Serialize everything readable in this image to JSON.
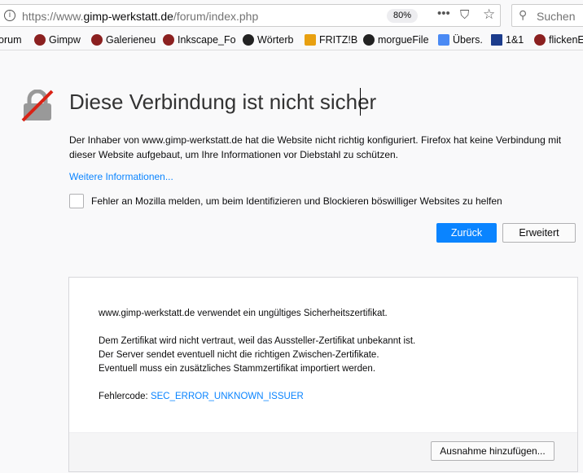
{
  "toolbar": {
    "url_prefix": "https://www.",
    "url_domain": "gimp-werkstatt.de",
    "url_path": "/forum/index.php",
    "zoom": "80%",
    "search_placeholder": "Suchen"
  },
  "bookmarks": [
    "orum",
    "Gimpw",
    "Galerieneu",
    "Inkscape_Fo",
    "Wörterb",
    "FRITZ!B",
    "morgueFile",
    "Übers.",
    "1&1",
    "flickenE"
  ],
  "error": {
    "title": "Diese Verbindung ist nicht sicher",
    "description": "Der Inhaber von www.gimp-werkstatt.de hat die Website nicht richtig konfiguriert. Firefox hat keine Verbindung mit dieser Website aufgebaut, um Ihre Informationen vor Diebstahl zu schützen.",
    "more_link": "Weitere Informationen...",
    "report_label": "Fehler an Mozilla melden, um beim Identifizieren und Blockieren böswilliger Websites zu helfen",
    "back_button": "Zurück",
    "advanced_button": "Erweitert"
  },
  "advanced": {
    "line1": "www.gimp-werkstatt.de verwendet ein ungültiges Sicherheitszertifikat.",
    "line2": "Dem Zertifikat wird nicht vertraut, weil das Aussteller-Zertifikat unbekannt ist.",
    "line3": "Der Server sendet eventuell nicht die richtigen Zwischen-Zertifikate.",
    "line4": "Eventuell muss ein zusätzliches Stammzertifikat importiert werden.",
    "code_label": "Fehlercode:",
    "code": "SEC_ERROR_UNKNOWN_ISSUER",
    "exception_button": "Ausnahme hinzufügen..."
  }
}
